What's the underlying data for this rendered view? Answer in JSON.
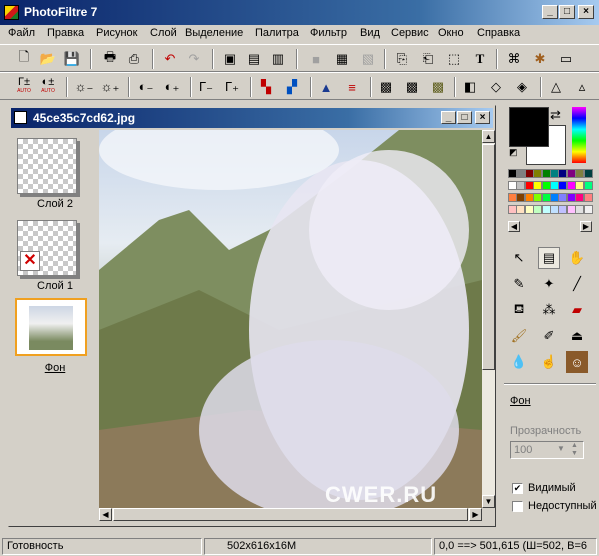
{
  "app": {
    "title": "PhotoFiltre 7"
  },
  "menu": [
    "Файл",
    "Правка",
    "Рисунок",
    "Слой",
    "Выделение",
    "Палитра",
    "Фильтр",
    "Вид",
    "Сервис",
    "Окно",
    "Справка"
  ],
  "toolbar2": {
    "auto1": "AUTO",
    "auto2": "AUTO"
  },
  "document": {
    "title": "45ce35c7cd62.jpg"
  },
  "layers": [
    {
      "name": "Слой 2"
    },
    {
      "name": "Слой 1"
    },
    {
      "name": "Фон"
    }
  ],
  "watermark": "CWER.RU",
  "colors": {
    "foreground": "#000000",
    "background": "#ffffff",
    "palette": [
      "#000000",
      "#808080",
      "#800000",
      "#808000",
      "#008000",
      "#008080",
      "#000080",
      "#800080",
      "#808040",
      "#004040",
      "#ffffff",
      "#c0c0c0",
      "#ff0000",
      "#ffff00",
      "#00ff00",
      "#00ffff",
      "#0000ff",
      "#ff00ff",
      "#ffff80",
      "#00ff80",
      "#ff8040",
      "#804000",
      "#ff8000",
      "#80ff00",
      "#00ff40",
      "#0080ff",
      "#8080ff",
      "#8000ff",
      "#ff0080",
      "#ff8080",
      "#ffc0c0",
      "#ffe0c0",
      "#ffffc0",
      "#c0ffc0",
      "#c0ffff",
      "#c0e0ff",
      "#c0c0ff",
      "#ffc0ff",
      "#e0e0e0",
      "#f0f0f0"
    ]
  },
  "props": {
    "layer_name": "Фон",
    "opacity_label": "Прозрачность",
    "opacity_value": "100",
    "visible_label": "Видимый",
    "visible_checked": true,
    "locked_label": "Недоступный",
    "locked_checked": false
  },
  "status": {
    "left": "Готовность",
    "size": "502x616x16M",
    "coords": "0,0 ==> 501,615 (Ш=502, В=6"
  }
}
